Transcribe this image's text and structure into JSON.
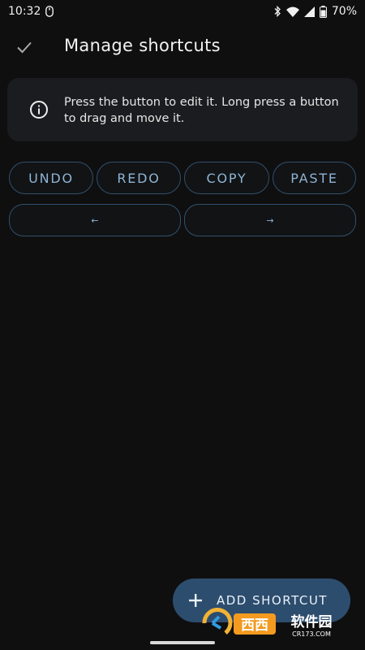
{
  "status_bar": {
    "time": "10:32",
    "battery": "70%",
    "icons": [
      "mouse-icon",
      "bluetooth-icon",
      "wifi-icon",
      "signal-icon",
      "battery-icon"
    ]
  },
  "app_bar": {
    "title": "Manage shortcuts",
    "confirm_icon": "check-icon"
  },
  "info_card": {
    "icon": "info-icon",
    "text": "Press the button to edit it. Long press a button to drag and move it."
  },
  "shortcuts": {
    "row1": [
      "UNDO",
      "REDO",
      "COPY",
      "PASTE"
    ],
    "row2": [
      "←",
      "→"
    ]
  },
  "fab": {
    "icon": "plus-icon",
    "label": "ADD SHORTCUT"
  },
  "watermark": {
    "text": "西西软件园",
    "subtext": "CR173.COM"
  },
  "colors": {
    "background": "#0f0f10",
    "card": "#1b1c1f",
    "button_border": "#32506a",
    "button_text": "#8fb4d4",
    "fab": "#2d4d6e"
  }
}
